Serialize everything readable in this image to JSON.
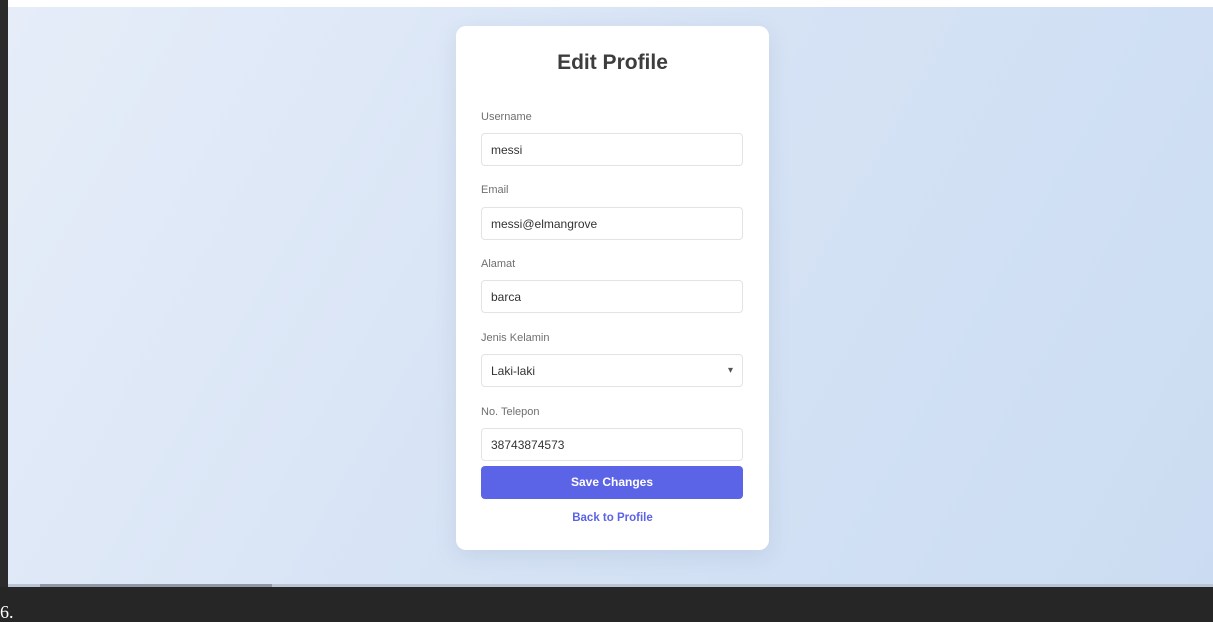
{
  "form": {
    "title": "Edit Profile",
    "fields": [
      {
        "label": "Username",
        "value": "messi"
      },
      {
        "label": "Email",
        "value": "messi@elmangrove"
      },
      {
        "label": "Alamat",
        "value": "barca"
      },
      {
        "label": "Jenis Kelamin",
        "value": "Laki-laki"
      },
      {
        "label": "No. Telepon",
        "value": "38743874573"
      }
    ],
    "select_icon": "chevron-down-icon",
    "save_label": "Save Changes",
    "back_label": "Back to Profile"
  },
  "step_label": "6.",
  "colors": {
    "accent": "#5b63e6",
    "card_background": "#ffffff",
    "page_background": "#d6e3f5",
    "bottom_band": "#262626"
  }
}
